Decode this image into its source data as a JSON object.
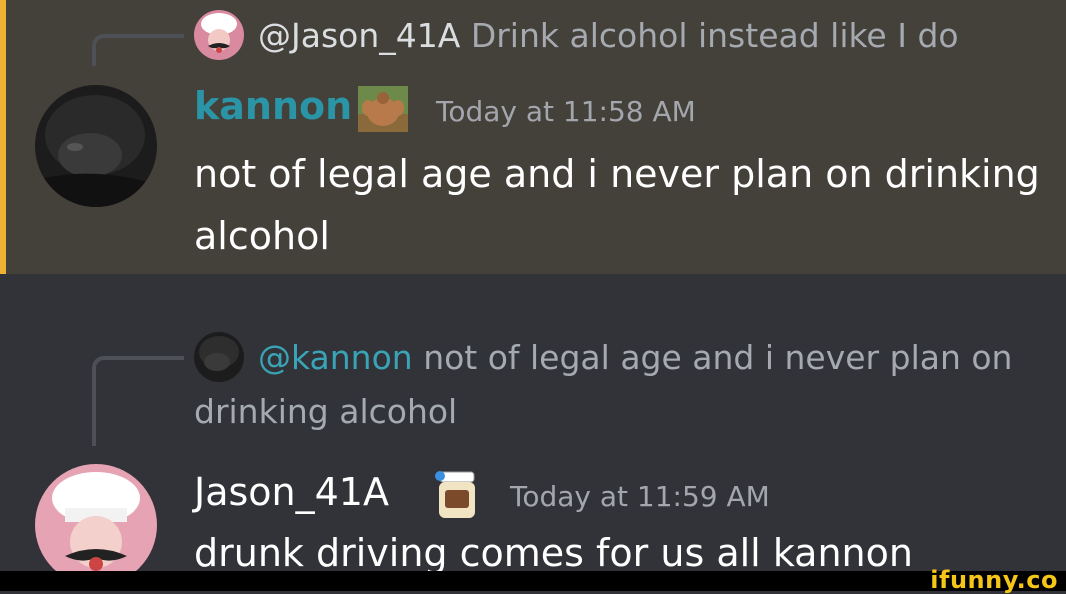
{
  "messages": [
    {
      "reply": {
        "name": "@Jason_41A",
        "content": "Drink alcohol instead like I do"
      },
      "author": "kannon",
      "timestamp": "Today at 11:58 AM",
      "text": "not of legal age and i never plan on drinking alcohol"
    },
    {
      "reply": {
        "name": "@kannon",
        "content": "not of legal age and i never plan on",
        "content_line2": "drinking alcohol"
      },
      "author": "Jason_41A",
      "timestamp": "Today at 11:59 AM",
      "text": "drunk driving comes for us all kannon"
    }
  ],
  "watermark": "ifunny.co",
  "colors": {
    "highlight_bg": "#44403a",
    "mention_bar": "#f0b232",
    "chat_bg": "#313338",
    "kannon_name": "#2b95a8"
  },
  "icons": {
    "jason_avatar": "chef-avatar-icon",
    "kannon_avatar": "dark-avatar-icon",
    "kannon_role": "muscle-man-role-icon",
    "jason_role": "mayo-jar-role-icon"
  }
}
